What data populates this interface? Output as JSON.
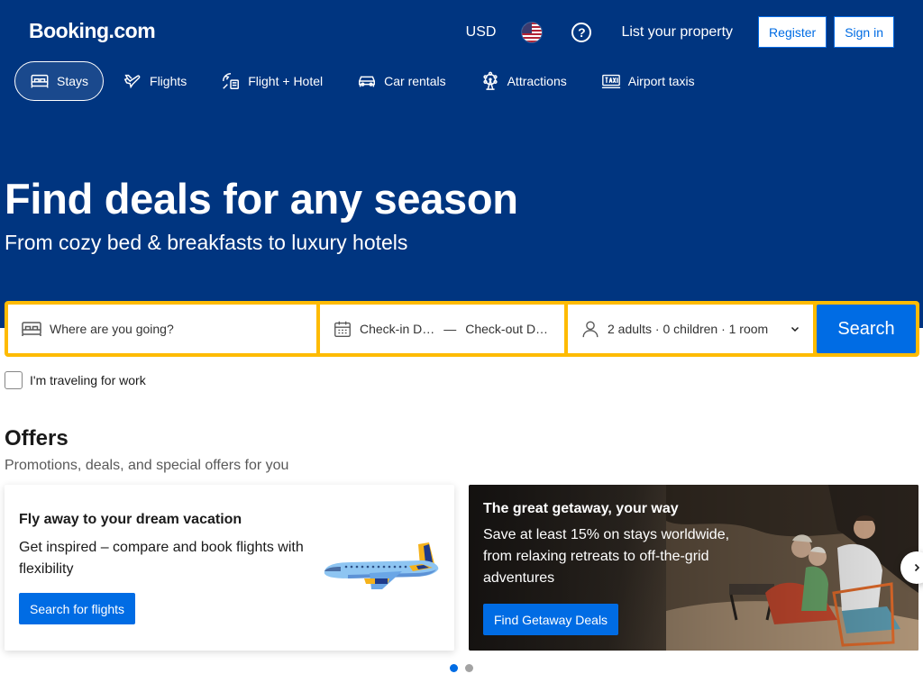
{
  "header": {
    "logo": "Booking.com",
    "currency": "USD",
    "flag_icon": "us-flag-icon",
    "help_symbol": "?",
    "list_property": "List your property",
    "register": "Register",
    "sign_in": "Sign in"
  },
  "nav": {
    "items": [
      {
        "label": "Stays",
        "icon": "bed-icon",
        "active": true
      },
      {
        "label": "Flights",
        "icon": "plane-icon"
      },
      {
        "label": "Flight + Hotel",
        "icon": "flight-hotel-icon"
      },
      {
        "label": "Car rentals",
        "icon": "car-icon"
      },
      {
        "label": "Attractions",
        "icon": "ferris-wheel-icon"
      },
      {
        "label": "Airport taxis",
        "icon": "taxi-icon"
      }
    ]
  },
  "hero": {
    "title": "Find deals for any season",
    "subtitle": "From cozy bed & breakfasts to luxury hotels"
  },
  "search": {
    "destination_placeholder": "Where are you going?",
    "checkin": "Check-in D…",
    "dash": "—",
    "checkout": "Check-out D…",
    "guests": "2 adults · 0 children · 1 room",
    "button": "Search",
    "work_label": "I'm traveling for work"
  },
  "offers": {
    "title": "Offers",
    "subtitle": "Promotions, deals, and special offers for you",
    "cards": [
      {
        "title": "Fly away to your dream vacation",
        "text": "Get inspired – compare and book flights with flexibility",
        "button": "Search for flights"
      },
      {
        "title": "The great getaway, your way",
        "text": "Save at least 15% on stays worldwide, from relaxing retreats to off-the-grid adventures",
        "button": "Find Getaway Deals"
      }
    ],
    "carousel_page": 1,
    "carousel_total": 2
  },
  "colors": {
    "brand_blue": "#003580",
    "action_blue": "#006ce4",
    "search_border": "#febb02"
  }
}
